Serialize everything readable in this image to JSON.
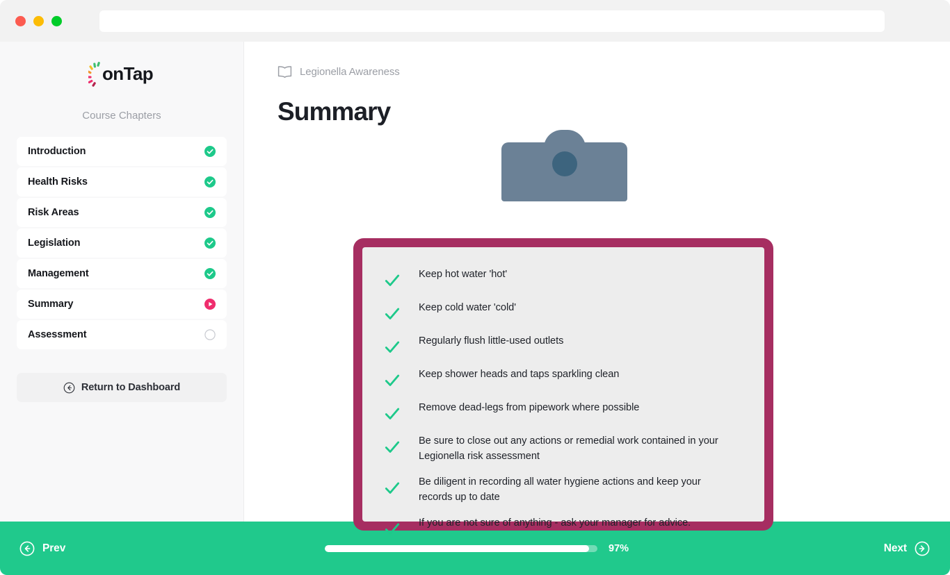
{
  "browser": {
    "url_value": "",
    "url_placeholder": "",
    "window_controls": [
      "close",
      "minimize",
      "maximize"
    ]
  },
  "sidebar": {
    "logo_text": "onTap",
    "section_title": "Course Chapters",
    "chapters": [
      {
        "label": "Introduction",
        "status": "complete"
      },
      {
        "label": "Health Risks",
        "status": "complete"
      },
      {
        "label": "Risk Areas",
        "status": "complete"
      },
      {
        "label": "Legislation",
        "status": "complete"
      },
      {
        "label": "Management",
        "status": "complete"
      },
      {
        "label": "Summary",
        "status": "current"
      },
      {
        "label": "Assessment",
        "status": "locked"
      }
    ],
    "return_button": "Return to Dashboard"
  },
  "main": {
    "breadcrumb": "Legionella Awareness",
    "breadcrumb_icon": "book-icon",
    "title": "Summary",
    "checklist": [
      "Keep hot water 'hot'",
      "Keep cold water 'cold'",
      "Regularly flush little-used outlets",
      "Keep shower heads and taps sparkling clean",
      "Remove dead-legs from pipework where possible",
      "Be sure to close out any actions or remedial work contained in your Legionella risk assessment",
      "Be diligent in recording all water hygiene actions and keep your records up to date",
      "If you are not sure of anything - ask your manager for advice."
    ]
  },
  "footer": {
    "prev_label": "Prev",
    "next_label": "Next",
    "progress_percent": 97,
    "progress_label": "97%"
  },
  "colors": {
    "accent_green": "#20c98c",
    "check_green": "#1dc98a",
    "current_pink": "#ef2d6d",
    "clipboard_border": "#a62e61",
    "clipboard_inner": "#ededed",
    "clip_metal": "#6b8196",
    "clip_hole": "#3d647e",
    "sidebar_bg": "#f8f8f9",
    "text_dark": "#1c1f26",
    "text_muted": "#9b9ea5"
  }
}
